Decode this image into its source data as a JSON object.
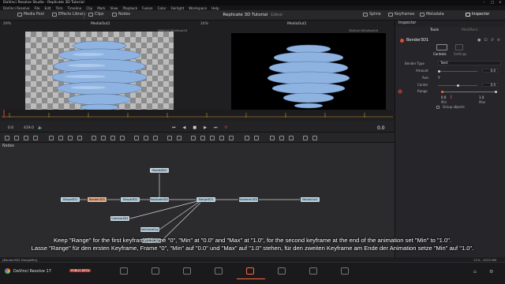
{
  "window": {
    "title": "DaVinci Resolve Studio - Replicate 3D Tutorial",
    "menu": [
      "DaVinci Resolve",
      "File",
      "Edit",
      "Trim",
      "Timeline",
      "Clip",
      "Mark",
      "View",
      "Playback",
      "Fusion",
      "Color",
      "Fairlight",
      "Workspace",
      "Help"
    ]
  },
  "toolbar": {
    "media_pool": "Media Pool",
    "effects_library": "Effects Library",
    "clips": "Clips",
    "nodes": "Nodes",
    "project_title": "Replicate 3D Tutorial",
    "edited_state": "Edited",
    "spline": "Spline",
    "keyframes": "Keyframes",
    "metadata": "Metadata",
    "inspector": "Inspector"
  },
  "viewer_left": {
    "zoom": "29%",
    "title": "MediaOut1",
    "resolution": "3840x2160xfloat16"
  },
  "viewer_right": {
    "zoom": "24%",
    "title": "MediaOut1",
    "resolution": "3840x2160xfloat16"
  },
  "timeline": {
    "start": "0.0",
    "end": "419.0",
    "current": "0.0"
  },
  "nodes_panel": {
    "label": "Nodes",
    "nodes": [
      {
        "id": "shape3d2",
        "label": "Shape3D2"
      },
      {
        "id": "shape3d1",
        "label": "Shape3D1"
      },
      {
        "id": "bender3d1",
        "label": "Bender3D1"
      },
      {
        "id": "shade3d2",
        "label": "Shade3D2"
      },
      {
        "id": "replicate3d1",
        "label": "Replicate3D1"
      },
      {
        "id": "merge3d1",
        "label": "Merge3D1"
      },
      {
        "id": "renderer3d1",
        "label": "Renderer3D1"
      },
      {
        "id": "mediaout1",
        "label": "MediaOut1"
      },
      {
        "id": "camera3d1",
        "label": "Camera3D1"
      },
      {
        "id": "directional1",
        "label": "DirectionalLig..."
      },
      {
        "id": "directional2",
        "label": "DirectionalLig..."
      }
    ]
  },
  "inspector": {
    "title": "Inspector",
    "tab_tools": "Tools",
    "tab_modifiers": "Modifiers",
    "node_name": "Bender3D1",
    "subtab_controls": "Controls",
    "subtab_settings": "Settings",
    "bender_type_label": "Bender Type",
    "bender_type_value": "Twist",
    "amount_label": "Amount",
    "amount_value": "0.0",
    "axis_label": "Axis",
    "axis_value": "Y",
    "center_label": "Center",
    "center_value": "0.0",
    "range_label": "Range",
    "range_min_value": "0.0",
    "range_max_value": "1.0",
    "range_min_label": "Min",
    "range_max_label": "Max",
    "group_objects_label": "Group objects",
    "range_level": 0.0
  },
  "statusbar": {
    "left": "[Bender3D1 RangeMin]",
    "right": "11% - 4233 MB"
  },
  "pagebar": {
    "app": "DaVinci Resolve 17",
    "badge": "PUBLIC BETA"
  },
  "subtitles": {
    "line1": "Keep \"Range\" for the first keyframe, frame \"0\", \"Min\" at \"0.0\" and \"Max\" at \"1.0\", for the second keyframe at the end of the animation set \"Min\" to \"1.0\".",
    "line2": "Lasse \"Range\" für den ersten Keyframe, Frame \"0\", \"Min\" auf \"0.0\" und \"Max\" auf \"1.0\" stehen, für den zweiten Keyframe am Ende der Animation setze \"Min\" auf \"1.0\"."
  },
  "colors": {
    "accent": "#ff6b3d",
    "node": "#aac7d6",
    "node_selected": "#d9a27c",
    "object_blue": "#8fb3e0"
  }
}
